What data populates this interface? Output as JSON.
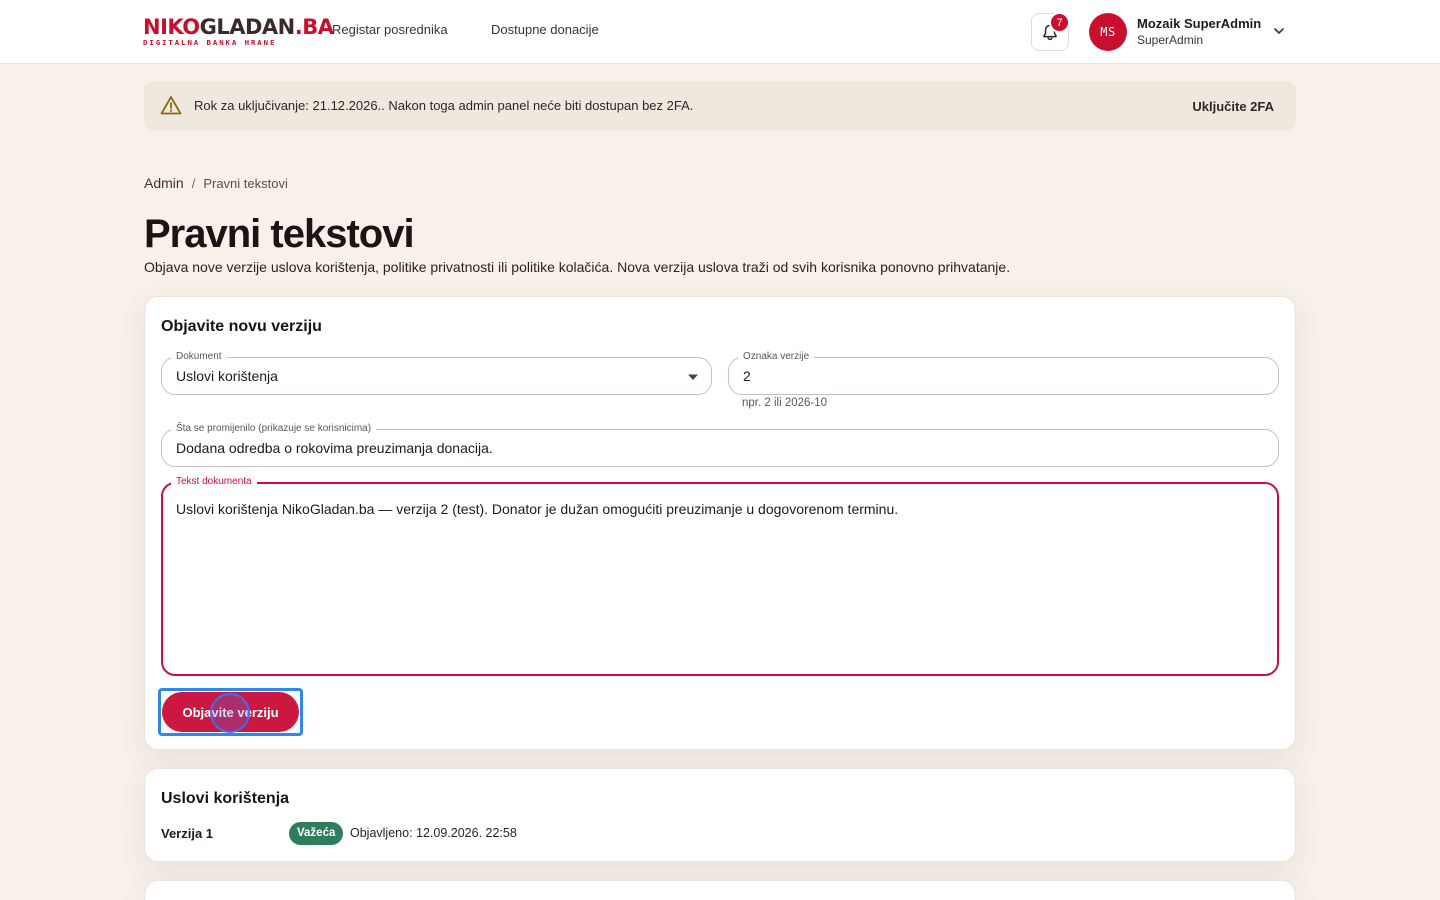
{
  "header": {
    "logo": {
      "part1": "NIKO",
      "part2": "GLADAN",
      "part3": ".BA",
      "tagline": "DIGITALNA BANKA HRANE"
    },
    "nav": [
      {
        "label": "Registar posrednika"
      },
      {
        "label": "Dostupne donacije"
      }
    ],
    "notifications_count": "7",
    "user": {
      "initials": "MS",
      "name": "Mozaik SuperAdmin",
      "role": "SuperAdmin"
    }
  },
  "banner": {
    "message": "Rok za uključivanje: 21.12.2026.. Nakon toga admin panel neće biti dostupan bez 2FA.",
    "action_label": "Uključite 2FA"
  },
  "breadcrumb": {
    "root": "Admin",
    "separator": "/",
    "current": "Pravni tekstovi"
  },
  "page": {
    "title": "Pravni tekstovi",
    "description": "Objava nove verzije uslova korištenja, politike privatnosti ili politike kolačića. Nova verzija uslova traži od svih korisnika ponovno prihvatanje."
  },
  "publish_form": {
    "title": "Objavite novu verziju",
    "document": {
      "label": "Dokument",
      "value": "Uslovi korištenja"
    },
    "version": {
      "label": "Oznaka verzije",
      "value": "2",
      "helper": "npr. 2 ili 2026-10"
    },
    "changes": {
      "label": "Šta se promijenilo (prikazuje se korisnicima)",
      "value": "Dodana odredba o rokovima preuzimanja donacija."
    },
    "text": {
      "label": "Tekst dokumenta",
      "value": "Uslovi korištenja NikoGladan.ba — verzija 2 (test). Donator je dužan omogućiti preuzimanje u dogovorenom terminu."
    },
    "submit_label": "Objavite verziju"
  },
  "documents": [
    {
      "title": "Uslovi korištenja",
      "versions": [
        {
          "label": "Verzija 1",
          "status": "Važeća",
          "published": "Objavljeno: 12.09.2026. 22:58"
        }
      ]
    }
  ],
  "colors": {
    "brand_red": "#c8102e",
    "button_red": "#cc1741",
    "status_green": "#2e7d5b",
    "focus_blue": "#2f86f0",
    "page_background": "#f7f1ea"
  }
}
